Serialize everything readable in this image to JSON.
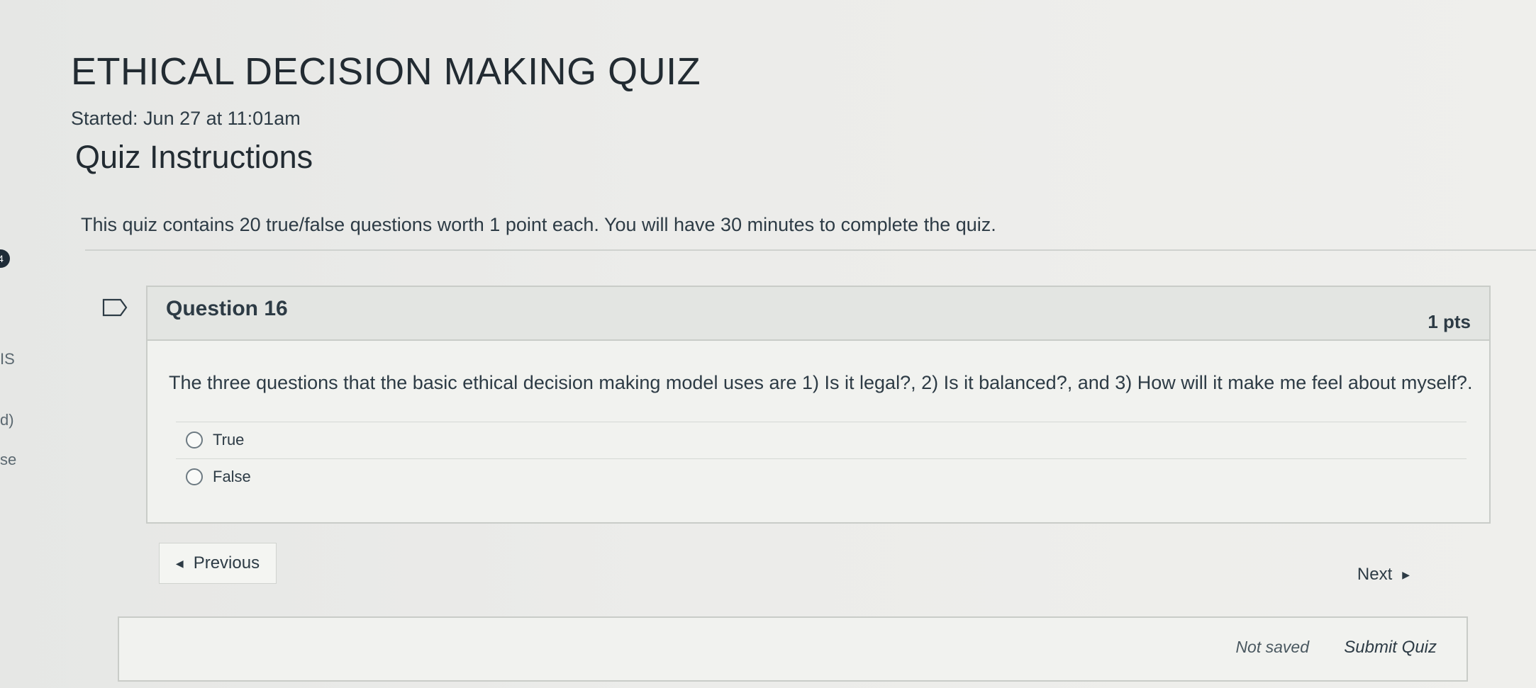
{
  "quiz": {
    "title": "ETHICAL DECISION MAKING QUIZ",
    "started": "Started: Jun 27 at 11:01am",
    "instructions_heading": "Quiz Instructions",
    "instructions_text": "This quiz contains 20 true/false questions worth 1 point each. You will have 30 minutes to complete the quiz."
  },
  "left_panel": {
    "badge": "4",
    "fragments": [
      "IS",
      "d)",
      "se"
    ]
  },
  "question": {
    "number_label": "Question 16",
    "points": "1 pts",
    "text": "The three questions that the basic ethical decision making model uses are 1) Is it legal?, 2) Is it balanced?, and 3) How will it make me feel about myself?.",
    "answers": [
      {
        "label": "True",
        "selected": false
      },
      {
        "label": "False",
        "selected": false
      }
    ]
  },
  "navigation": {
    "previous_label": "Previous",
    "next_label": "Next"
  },
  "footer": {
    "status": "Not saved",
    "submit_label": "Submit Quiz"
  },
  "icons": {
    "flag": "flag-icon",
    "prev": "chevron-left-icon",
    "next": "chevron-right-icon"
  }
}
